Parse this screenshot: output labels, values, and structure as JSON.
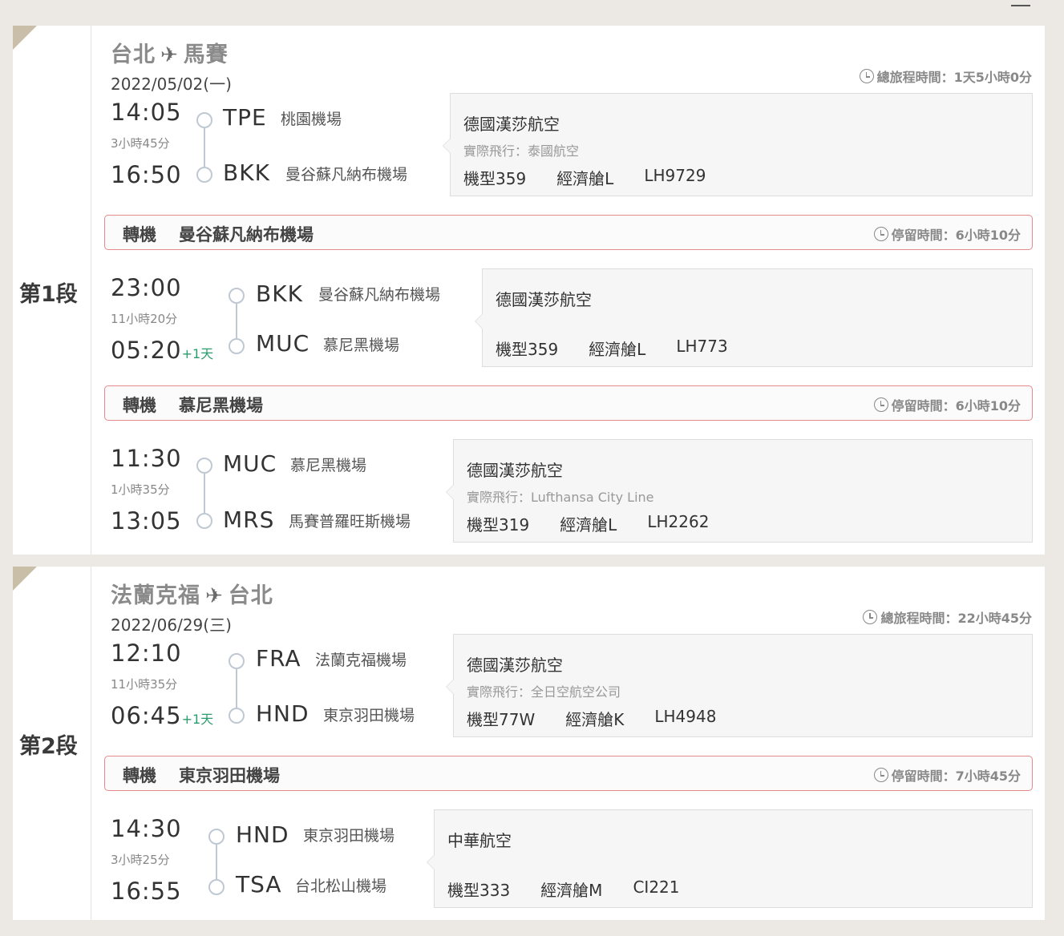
{
  "segments": [
    {
      "label_prefix": "第",
      "label_num": "1",
      "label_suffix": "段",
      "origin_city": "台北",
      "destination_city": "馬賽",
      "date": "2022/05/02(一)",
      "total_label": "總旅程時間：1天5小時0分",
      "legs": [
        {
          "dep_time": "14:05",
          "dep_plus": "",
          "duration": "3小時45分",
          "arr_time": "16:50",
          "arr_plus": "",
          "dep_code": "TPE",
          "dep_airport": "桃園機場",
          "arr_code": "BKK",
          "arr_airport": "曼谷蘇凡納布機場",
          "airline": "德國漢莎航空",
          "operated_by": "實際飛行：泰國航空",
          "aircraft": "機型359",
          "cabin": "經濟艙L",
          "flight_no": "LH9729"
        },
        {
          "dep_time": "23:00",
          "dep_plus": "",
          "duration": "11小時20分",
          "arr_time": "05:20",
          "arr_plus": "+1天",
          "dep_code": "BKK",
          "dep_airport": "曼谷蘇凡納布機場",
          "arr_code": "MUC",
          "arr_airport": "慕尼黑機場",
          "airline": "德國漢莎航空",
          "operated_by": "",
          "aircraft": "機型359",
          "cabin": "經濟艙L",
          "flight_no": "LH773"
        },
        {
          "dep_time": "11:30",
          "dep_plus": "",
          "duration": "1小時35分",
          "arr_time": "13:05",
          "arr_plus": "",
          "dep_code": "MUC",
          "dep_airport": "慕尼黑機場",
          "arr_code": "MRS",
          "arr_airport": "馬賽普羅旺斯機場",
          "airline": "德國漢莎航空",
          "operated_by": "實際飛行：Lufthansa City Line",
          "aircraft": "機型319",
          "cabin": "經濟艙L",
          "flight_no": "LH2262"
        }
      ],
      "transfers": [
        {
          "label": "轉機",
          "airport": "曼谷蘇凡納布機場",
          "stay": "停留時間：6小時10分"
        },
        {
          "label": "轉機",
          "airport": "慕尼黑機場",
          "stay": "停留時間：6小時10分"
        }
      ]
    },
    {
      "label_prefix": "第",
      "label_num": "2",
      "label_suffix": "段",
      "origin_city": "法蘭克福",
      "destination_city": "台北",
      "date": "2022/06/29(三)",
      "total_label": "總旅程時間：22小時45分",
      "legs": [
        {
          "dep_time": "12:10",
          "dep_plus": "",
          "duration": "11小時35分",
          "arr_time": "06:45",
          "arr_plus": "+1天",
          "dep_code": "FRA",
          "dep_airport": "法蘭克福機場",
          "arr_code": "HND",
          "arr_airport": "東京羽田機場",
          "airline": "德國漢莎航空",
          "operated_by": "實際飛行：全日空航空公司",
          "aircraft": "機型77W",
          "cabin": "經濟艙K",
          "flight_no": "LH4948"
        },
        {
          "dep_time": "14:30",
          "dep_plus": "",
          "duration": "3小時25分",
          "arr_time": "16:55",
          "arr_plus": "",
          "dep_code": "HND",
          "dep_airport": "東京羽田機場",
          "arr_code": "TSA",
          "arr_airport": "台北松山機場",
          "airline": "中華航空",
          "operated_by": "",
          "aircraft": "機型333",
          "cabin": "經濟艙M",
          "flight_no": "CI221"
        }
      ],
      "transfers": [
        {
          "label": "轉機",
          "airport": "東京羽田機場",
          "stay": "停留時間：7小時45分"
        }
      ]
    }
  ],
  "icons": {
    "plane": "airplane-icon",
    "clock": "clock-icon"
  }
}
